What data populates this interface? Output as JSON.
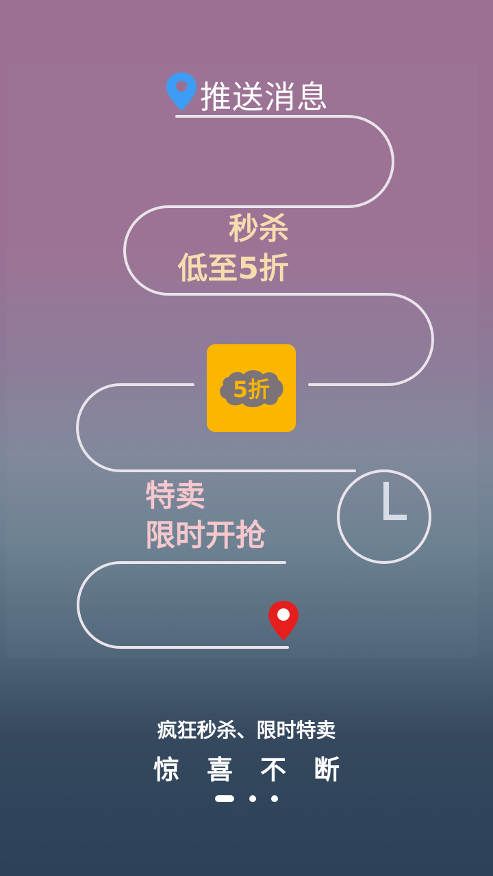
{
  "header": {
    "title": "推送消息",
    "pin_icon": "location-pin-icon",
    "pin_color": "#3d9df5"
  },
  "promo_flash": {
    "line1": "秒杀",
    "line2": "低至5折",
    "color": "#f6ddb0"
  },
  "discount_badge": {
    "label": "5折",
    "tile_color": "#fbb600",
    "cloud_color": "#7c7378"
  },
  "promo_special": {
    "line1": "特卖",
    "line2": "限时开抢",
    "color": "#f6c7cc"
  },
  "clock": {
    "icon": "clock-icon"
  },
  "end_pin": {
    "icon": "location-pin-icon",
    "color": "#e61e1e"
  },
  "footer": {
    "slogan": "疯狂秒杀、限时特卖",
    "tagline": "惊喜不断"
  },
  "pager": {
    "count": 3,
    "active_index": 0
  }
}
